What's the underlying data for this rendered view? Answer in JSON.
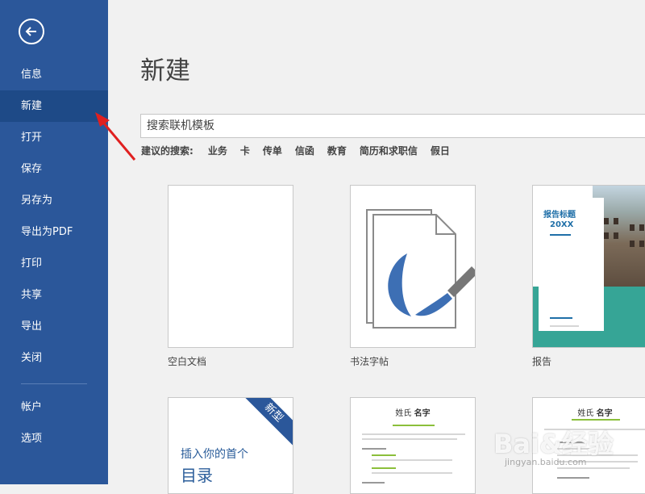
{
  "sidebar": {
    "items": [
      {
        "label": "信息"
      },
      {
        "label": "新建"
      },
      {
        "label": "打开"
      },
      {
        "label": "保存"
      },
      {
        "label": "另存为"
      },
      {
        "label": "导出为PDF"
      },
      {
        "label": "打印"
      },
      {
        "label": "共享"
      },
      {
        "label": "导出"
      },
      {
        "label": "关闭"
      },
      {
        "label": "帐户"
      },
      {
        "label": "选项"
      }
    ],
    "selected": "新建"
  },
  "main": {
    "title": "新建",
    "search": {
      "placeholder": "搜索联机模板"
    },
    "suggested": {
      "label": "建议的搜索:",
      "items": [
        "业务",
        "卡",
        "传单",
        "信函",
        "教育",
        "简历和求职信",
        "假日"
      ]
    },
    "templates": [
      {
        "label": "空白文档"
      },
      {
        "label": "书法字帖"
      },
      {
        "label": "报告",
        "title": "报告标题",
        "year": "20XX"
      },
      {
        "toc_line1": "插入你的首个",
        "toc_line2": "目录",
        "badge": "新型"
      },
      {
        "name_surname": "姓氏",
        "name_given": "名字"
      },
      {
        "name_surname": "姓氏",
        "name_given": "名字"
      }
    ]
  },
  "watermark": {
    "text": "Bai&经验",
    "sub": "jingyan.baidu.com"
  },
  "colors": {
    "sidebar": "#2b579a",
    "selected": "#1e4a87",
    "accent_teal": "#36a596",
    "arrow": "#e02020"
  }
}
